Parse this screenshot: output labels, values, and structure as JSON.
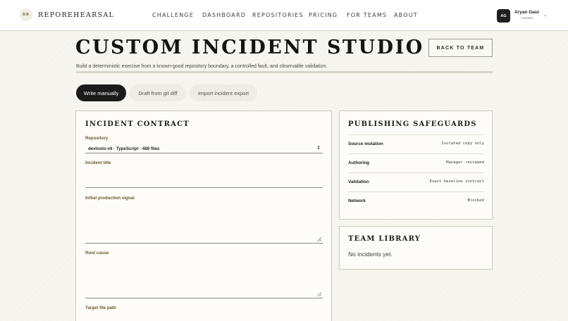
{
  "brand": {
    "mark": "RR",
    "name": "REPOREHEARSAL"
  },
  "nav": [
    {
      "label": "CHALLENGE"
    },
    {
      "label": "DASHBOARD"
    },
    {
      "label": "REPOSITORIES"
    },
    {
      "label": "PRICING"
    },
    {
      "label": "FOR TEAMS"
    },
    {
      "label": "ABOUT"
    }
  ],
  "account": {
    "initials": "AG",
    "name": "Aryan Gaur",
    "sublabel": "Account"
  },
  "page": {
    "title": "CUSTOM INCIDENT STUDIO",
    "subtitle": "Build a deterministic exercise from a known-good repository boundary, a controlled fault, and observable validation.",
    "back_label": "BACK TO TEAM"
  },
  "tabs": [
    {
      "label": "Write manually",
      "active": true
    },
    {
      "label": "Draft from git diff",
      "active": false
    },
    {
      "label": "Import incident export",
      "active": false
    }
  ],
  "contract": {
    "heading": "INCIDENT CONTRACT",
    "repository_label": "Repository",
    "repository_value": "devtools-v6 · TypeScript · 489 files",
    "title_label": "Incident title",
    "title_value": "",
    "signal_label": "Initial production signal",
    "signal_value": "",
    "root_cause_label": "Root cause",
    "root_cause_value": "",
    "target_path_label": "Target file path"
  },
  "safeguards": {
    "heading": "PUBLISHING SAFEGUARDS",
    "rows": [
      {
        "key": "Source mutation",
        "value": "Isolated copy only"
      },
      {
        "key": "Authoring",
        "value": "Manager reviewed"
      },
      {
        "key": "Validation",
        "value": "Exact baseline contract"
      },
      {
        "key": "Network",
        "value": "Blocked"
      }
    ]
  },
  "library": {
    "heading": "TEAM LIBRARY",
    "empty_text": "No incidents yet."
  },
  "colors": {
    "background": "#f7f5ef",
    "panel": "#fdfcf8",
    "label_accent": "#6d5a2c",
    "active_tab": "#1b1b1b"
  }
}
